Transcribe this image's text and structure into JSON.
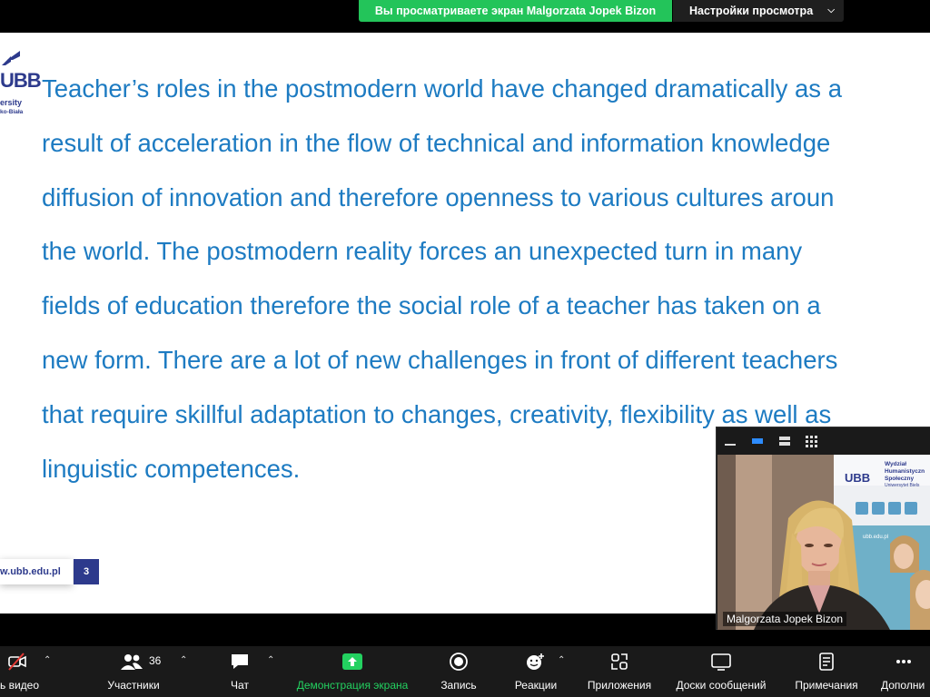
{
  "banner": {
    "share_text": "Вы просматриваете экран Malgorzata Jopek Bizon",
    "view_settings": "Настройки просмотра"
  },
  "slide": {
    "logo_text": "UBB",
    "logo_line1": "ersity",
    "logo_line2": "ko-Biała",
    "lines": [
      "Teacher’s roles in the postmodern world have changed dramatically as a",
      "result of acceleration in the flow of technical and information knowledge",
      "diffusion of innovation and therefore openness to various cultures aroun",
      "the world. The postmodern reality forces an unexpected turn in many",
      "fields of education therefore the social role of a teacher has taken on a",
      "new form. There are  a lot of new challenges in front of different teachers",
      "that require skillful adaptation to changes, creativity, flexibility as well as",
      "linguistic competences."
    ],
    "footer_url": "w.ubb.edu.pl",
    "page_number": "3",
    "text_color": "#1d7bc2",
    "brand_color": "#2d3a8c"
  },
  "video": {
    "participant_name": "Malgorzata Jopek Bizon",
    "banner_title": "Wydział Humanistyczno-Społeczny",
    "banner_ubb": "UBB",
    "banner_line1": "Wydział",
    "banner_line2": "Humanistyczn",
    "banner_line3": "Społeczny",
    "banner_line4": "Uniwersytet Biels",
    "banner_url": "ubb.edu.pl"
  },
  "toolbar": {
    "video": "ь видео",
    "participants": "Участники",
    "participants_count": "36",
    "chat": "Чат",
    "share": "Демонстрация экрана",
    "record": "Запись",
    "reactions": "Реакции",
    "apps": "Приложения",
    "whiteboards": "Доски сообщений",
    "notes": "Примечания",
    "more": "Дополни",
    "accent_green": "#23d160"
  }
}
